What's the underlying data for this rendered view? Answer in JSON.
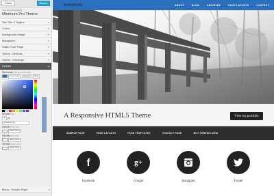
{
  "panel": {
    "close_label": "Close",
    "save_label": "Saved",
    "previewing_label": "You are previewing",
    "theme_name": "Minimum Pro Theme",
    "sections": [
      "Site Title & Tagline",
      "Colors",
      "Background Image",
      "Navigation",
      "Static Front Page",
      "Global - Defaults",
      "Global - Headings"
    ],
    "active_section": "Header",
    "header_settings": {
      "bg_label": "Site header",
      "bg_sub": "Background color",
      "current_color_label": "Current color",
      "hex_value": "#2a6cbd",
      "clear_label": "Clear",
      "size_label": "Site title",
      "size_sub": "size",
      "size_value": "30",
      "size_unit": "px",
      "font_value": "Google Fonts",
      "title_color_label": "Site title",
      "title_color_sub": "title color",
      "select_color_1": "Select Color",
      "link_label": "Site title",
      "link_sub": "link color",
      "select_color_2": "Select Color",
      "hover_label": "Site title",
      "hover_sub": "hover color",
      "select_color_3": "Select Color"
    },
    "bottom_section": "Menu - Header Right",
    "palette": [
      "#000000",
      "#ffffff",
      "#dd3333",
      "#dd9933",
      "#eeee22",
      "#81d742",
      "#1e73be",
      "#8224e3"
    ]
  },
  "site": {
    "logo": "MINIMUM",
    "nav": [
      "ABOUT",
      "BLOG",
      "ARCHIVES",
      "PAGE LAYOUTS",
      "CONTACT"
    ],
    "intro_title": "A Responsive HTML5 Theme",
    "portfolio_button": "View my portfolio",
    "subnav": [
      "SAMPLE PAGE",
      "PAGE LAYOUTS",
      "PAGE TEMPLATES",
      "CONTACT PAGE",
      "BUY GENESIS NOW"
    ],
    "social": [
      {
        "label": "Facebook",
        "glyph": "f",
        "icon": "facebook-icon"
      },
      {
        "label": "Google",
        "glyph": "g+",
        "icon": "google-plus-icon"
      },
      {
        "label": "Instagram",
        "glyph": "",
        "icon": "instagram-icon"
      },
      {
        "label": "Twitter",
        "glyph": "",
        "icon": "twitter-icon"
      }
    ]
  },
  "colors": {
    "header_blue": "#2b6fbd",
    "dark": "#222222"
  }
}
